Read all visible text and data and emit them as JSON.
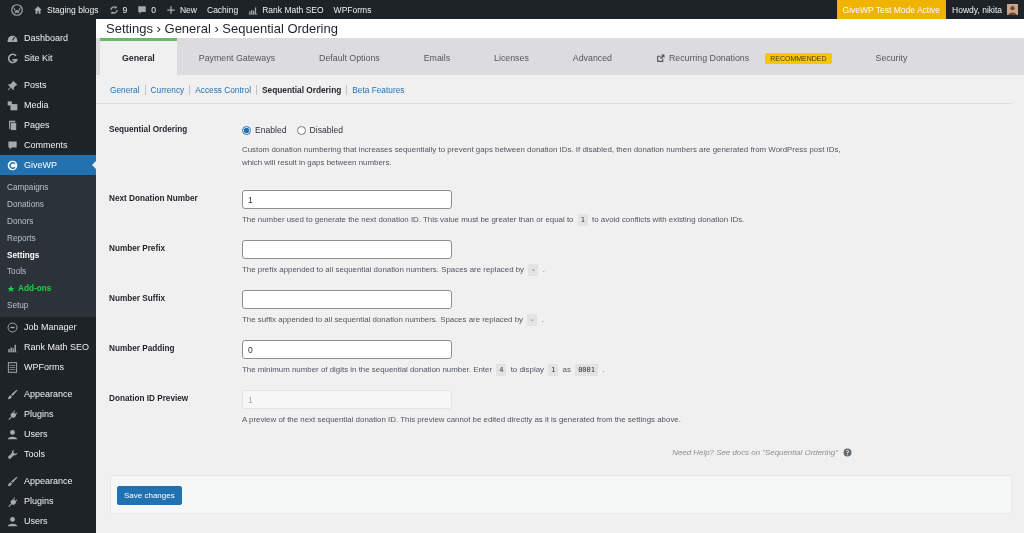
{
  "admin_bar": {
    "items": [
      {
        "kind": "wordpress"
      },
      {
        "kind": "home",
        "label": "Staging blogs"
      },
      {
        "kind": "updates",
        "label": "9"
      },
      {
        "kind": "comments",
        "label": "0"
      },
      {
        "kind": "new",
        "label": "New"
      },
      {
        "kind": "plain",
        "label": "Caching"
      },
      {
        "kind": "chart",
        "label": "Rank Math SEO"
      },
      {
        "kind": "plain",
        "label": "WPForms"
      }
    ],
    "test_mode": "GiveWP Test Mode Active",
    "greeting": "Howdy, nikita"
  },
  "sidebar": {
    "groups": [
      [
        {
          "kind": "dashboard",
          "label": "Dashboard",
          "selected": false
        },
        {
          "kind": "sitekit",
          "label": "Site Kit",
          "selected": false
        }
      ],
      [
        {
          "kind": "pin",
          "label": "Posts",
          "selected": false
        },
        {
          "kind": "media",
          "label": "Media",
          "selected": false
        },
        {
          "kind": "pages",
          "label": "Pages",
          "selected": false
        },
        {
          "kind": "comments",
          "label": "Comments",
          "selected": false
        },
        {
          "kind": "give",
          "label": "GiveWP",
          "selected": true,
          "children": [
            {
              "label": "Campaigns",
              "selected": false
            },
            {
              "label": "Donations",
              "selected": false
            },
            {
              "label": "Donors",
              "selected": false
            },
            {
              "label": "Reports",
              "selected": false
            },
            {
              "label": "Settings",
              "selected": true
            },
            {
              "label": "Tools",
              "selected": false
            },
            {
              "label": "Add-ons",
              "selected": false,
              "color": "#1ed14b",
              "kind": "star"
            },
            {
              "label": "Setup",
              "selected": false
            }
          ]
        },
        {
          "kind": "circle",
          "label": "Job Manager",
          "selected": false
        },
        {
          "kind": "chart",
          "label": "Rank Math SEO",
          "selected": false
        },
        {
          "kind": "form",
          "label": "WPForms",
          "selected": false
        }
      ],
      [
        {
          "kind": "brush",
          "label": "Appearance",
          "selected": false
        },
        {
          "kind": "plug",
          "label": "Plugins",
          "selected": false
        },
        {
          "kind": "user",
          "label": "Users",
          "selected": false
        },
        {
          "kind": "wrench",
          "label": "Tools",
          "selected": false
        }
      ],
      [
        {
          "kind": "brush",
          "label": "Appearance",
          "selected": false
        },
        {
          "kind": "plug",
          "label": "Plugins",
          "selected": false
        },
        {
          "kind": "user",
          "label": "Users",
          "selected": false
        }
      ]
    ]
  },
  "page_title": "Settings › General › Sequential Ordering",
  "tabs": [
    {
      "label": "General",
      "selected": true
    },
    {
      "label": "Payment Gateways",
      "selected": false
    },
    {
      "label": "Default Options",
      "selected": false
    },
    {
      "label": "Emails",
      "selected": false
    },
    {
      "label": "Licenses",
      "selected": false
    },
    {
      "label": "Advanced",
      "selected": false
    },
    {
      "label": "Recurring Donations",
      "selected": false,
      "kind": "external",
      "badge": "RECOMMENDED"
    },
    {
      "label": "Security",
      "selected": false
    }
  ],
  "subnav": [
    {
      "label": "General",
      "selected": false
    },
    {
      "label": "Currency",
      "selected": false
    },
    {
      "label": "Access Control",
      "selected": false
    },
    {
      "label": "Sequential Ordering",
      "selected": true
    },
    {
      "label": "Beta Features",
      "selected": false
    }
  ],
  "fields": [
    {
      "kind": "radio",
      "label": "Sequential Ordering",
      "options": [
        {
          "label": "Enabled",
          "selected": true
        },
        {
          "label": "Disabled",
          "selected": false
        }
      ],
      "description": [
        {
          "kind": "text",
          "text": "Custom donation numbering that increases sequentially to prevent gaps between donation IDs. If disabled, then donation numbers are generated from WordPress post IDs, which will result in gaps between numbers."
        }
      ]
    },
    {
      "kind": "text",
      "label": "Next Donation Number",
      "value": "1",
      "description": [
        {
          "kind": "text",
          "text": "The number used to generate the next donation ID. This value must be greater than or equal to"
        },
        {
          "kind": "code",
          "text": "1"
        },
        {
          "kind": "text",
          "text": "to avoid conflicts with existing donation IDs."
        }
      ]
    },
    {
      "kind": "text",
      "label": "Number Prefix",
      "description": [
        {
          "kind": "text",
          "text": "The prefix appended to all sequential donation numbers. Spaces are replaced by"
        },
        {
          "kind": "code",
          "text": "-"
        },
        {
          "kind": "text",
          "text": "."
        }
      ]
    },
    {
      "kind": "text",
      "label": "Number Suffix",
      "description": [
        {
          "kind": "text",
          "text": "The suffix appended to all sequential donation numbers. Spaces are replaced by"
        },
        {
          "kind": "code",
          "text": "-"
        },
        {
          "kind": "text",
          "text": "."
        }
      ]
    },
    {
      "kind": "text",
      "label": "Number Padding",
      "value": "0",
      "description": [
        {
          "kind": "text",
          "text": "The minimum number of digits in the sequential donation number. Enter"
        },
        {
          "kind": "code",
          "text": "4"
        },
        {
          "kind": "text",
          "text": "to display"
        },
        {
          "kind": "code",
          "text": "1"
        },
        {
          "kind": "text",
          "text": "as"
        },
        {
          "kind": "code",
          "text": "0001"
        },
        {
          "kind": "text",
          "text": "."
        }
      ]
    },
    {
      "kind": "readonly",
      "label": "Donation ID Preview",
      "value": "1",
      "description": [
        {
          "kind": "text",
          "text": "A preview of the next sequential donation ID. This preview cannot be edited directly as it is generated from the settings above."
        }
      ]
    }
  ],
  "help": "Need Help? See docs on \"Sequential Ordering\"",
  "save_button": "Save changes"
}
